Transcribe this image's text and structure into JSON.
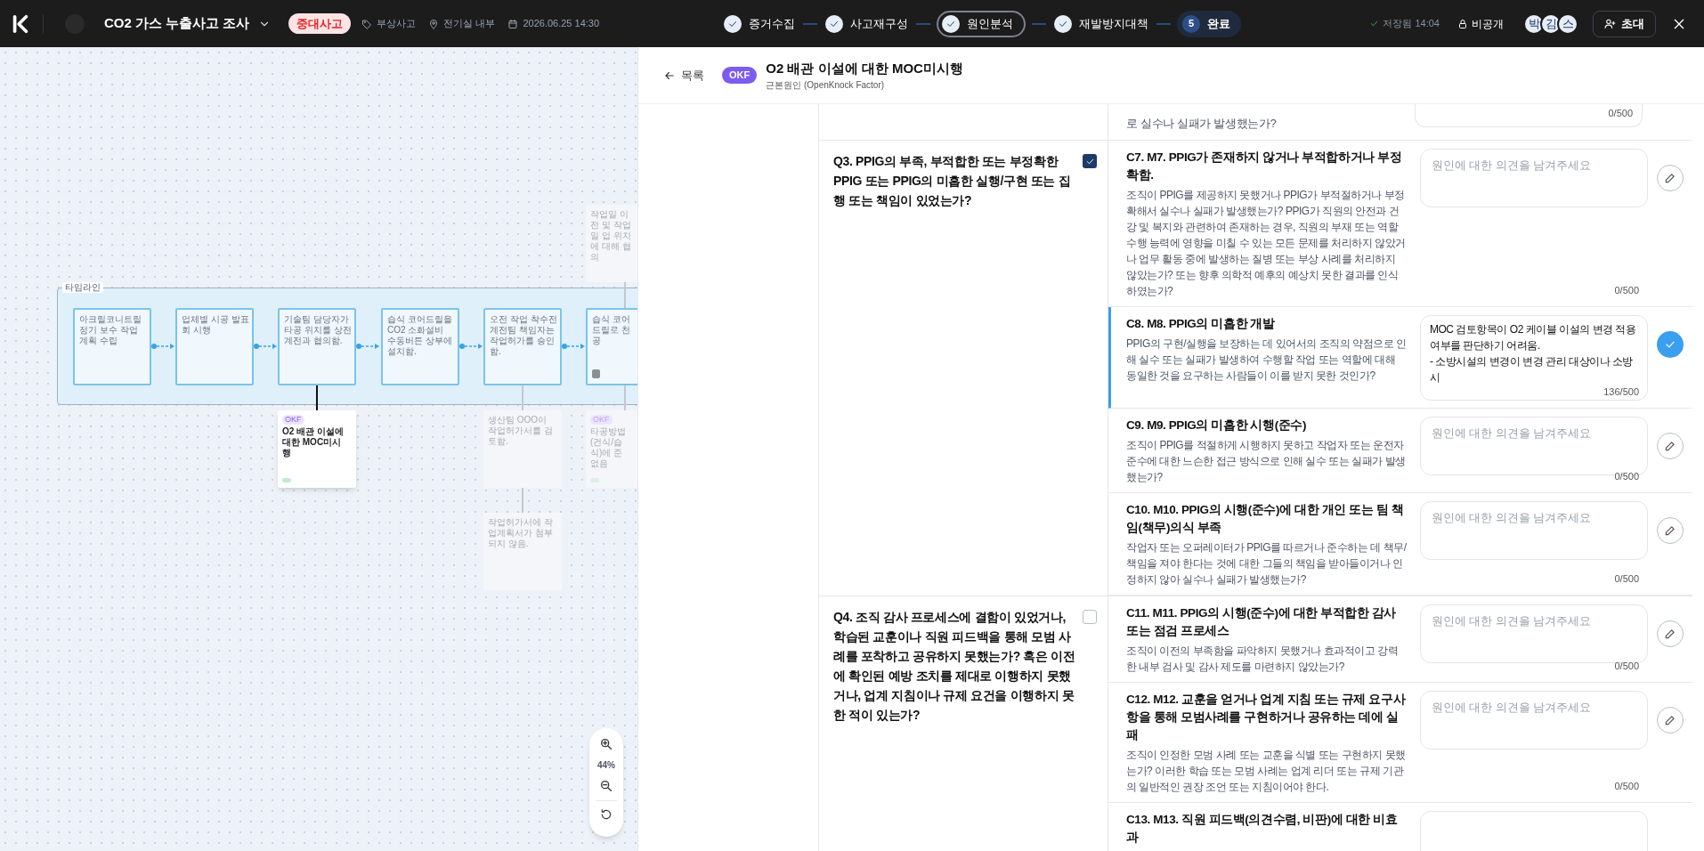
{
  "topbar": {
    "title": "CO2 가스 누출사고 조사",
    "severity": "중대사고",
    "meta": [
      {
        "kind": "tag",
        "text": "부상사고"
      },
      {
        "kind": "location",
        "text": "전기실 내부"
      },
      {
        "kind": "date",
        "text": "2026.06.25 14:30"
      }
    ],
    "steps": [
      {
        "label": "증거수집",
        "completed": true,
        "selected": false
      },
      {
        "label": "사고재구성",
        "completed": true,
        "selected": false
      },
      {
        "label": "원인분석",
        "completed": true,
        "selected": true
      },
      {
        "label": "재발방지대책",
        "completed": true,
        "selected": false
      },
      {
        "label": "완료",
        "completed": false,
        "selected": false,
        "number": "5"
      }
    ],
    "save_status": "저장됨 14:04",
    "visibility": "비공개",
    "avatars": [
      "박",
      "김",
      "스"
    ],
    "invite": "초대"
  },
  "canvas": {
    "group_label": "타임라인",
    "timeline_nodes": [
      {
        "text": "아크릴코니트릴 정기 보수 작업 계획 수립",
        "has_icon": false
      },
      {
        "text": "업체별 시공 발표회 시행",
        "has_icon": false
      },
      {
        "text": "기술팀 담당자가 타공 위치를 상전계전과 협의함.",
        "has_icon": false,
        "below": [
          {
            "kind": "okf",
            "badge": "OKF",
            "text": "O2 배관 이설에 대한 MOC미시행",
            "faded": false
          }
        ]
      },
      {
        "text": "습식 코어드릴을 CO2 소화설비 수동버튼 상부에 설치함.",
        "has_icon": false
      },
      {
        "text": "오전 작업 착수전 계전팀 책임자는 작업허가를 승인함.",
        "has_icon": false,
        "below": [
          {
            "kind": "note",
            "text": "생산팀 OOO이 작업허가서를 검토함.",
            "faded": true
          },
          {
            "kind": "note",
            "text": "작업허가서에 작업계획서가 첨부되지 않음.",
            "faded": true
          }
        ]
      },
      {
        "text": "습식 코어드릴로 천공",
        "has_icon": true,
        "above": [
          {
            "kind": "note",
            "text": "작업일 이전 및 작업일 업 위치에 대해 협의",
            "faded": true
          }
        ],
        "below": [
          {
            "kind": "okf",
            "badge": "OKF",
            "text": "타공방법(건식/습식)에 준 없음",
            "faded": true
          }
        ]
      }
    ],
    "zoom_level": "44%"
  },
  "panel": {
    "back": "목록",
    "badge": "OKF",
    "title": "O2 배관 이설에 대한 MOC미시행",
    "subtitle": "근본원인 (OpenKnock Factor)",
    "partial_row": {
      "text": "로 실수나 실패가 발생했는가?",
      "count": "0/500"
    },
    "questions": [
      {
        "text": "Q3. PPIG의 부족, 부적합한 또는 부정확한 PPIG 또는 PPIG의 미흡한 실행/구현 또는 집행 또는 책임이 있었는가?",
        "checked": true,
        "criteria": [
          {
            "title": "C7. M7. PPIG가 존재하지 않거나 부적합하거나 부정확함.",
            "description": "조직이 PPIG를 제공하지 못했거나 PPIG가 부적절하거나 부정확해서 실수나 실패가 발생했는가? PPIG가 직원의 안전과 건강 및 복지와 관련하여 존재하는 경우, 직원의 부재 또는 역할 수행 능력에 영향을 미칠 수 있는 모든 문제를 처리하지 않았거나 업무 활동 중에 발생하는 질병 또는 부상 사례를 처리하지 않았는가? 또는 향후 의학적 예후의 예상치 못한 결과를 인식하였는가?",
            "placeholder": "원인에 대한 의견을 남겨주세요",
            "count": "0/500",
            "selected": false,
            "saved": false
          },
          {
            "title": "C8. M8. PPIG의 미흡한 개발",
            "description": "PPIG의 구현/실행을 보장하는 데 있어서의 조직의 약점으로 인해 실수 또는 실패가 발생하여 수행할 작업 또는 역할에 대해 동일한 것을 요구하는 사람들이 이를 받지 못한 것인가?",
            "value": "MOC 검토항목이 O2 케이블 이설의 변경 적용여부를 판단하기 어려움.\n- 소방시설의 변경이 변경 관리 대상이나 소방 시",
            "count": "136/500",
            "selected": true,
            "saved": true
          },
          {
            "title": "C9. M9. PPIG의 미흡한 시행(준수)",
            "description": "조직이 PPIG를 적절하게 시행하지 못하고 작업자 또는 운전자 준수에 대한 느슨한 접근 방식으로 인해 실수 또는 실패가 발생했는가?",
            "placeholder": "원인에 대한 의견을 남겨주세요",
            "count": "0/500",
            "selected": false,
            "saved": false
          },
          {
            "title": "C10. M10. PPIG의 시행(준수)에 대한 개인 또는 팀 책임(책무)의식 부족",
            "description": "작업자 또는 오퍼레이터가 PPIG를 따르거나 준수하는 데 책무/책임을 져야 한다는 것에 대한 그들의 책임을 받아들이거나 인정하지 않아 실수나 실패가 발생했는가?",
            "placeholder": "원인에 대한 의견을 남겨주세요",
            "count": "0/500",
            "selected": false,
            "saved": false
          }
        ]
      },
      {
        "text": "Q4. 조직 감사 프로세스에 결함이 있었거나, 학습된 교훈이나 직원 피드백을 통해 모범 사례를 포착하고 공유하지 못했는가? 혹은 이전에 확인된 예방 조치를 제대로 이행하지 못했거나, 업계 지침이나 규제 요건을 이행하지 못한 적이 있는가?",
        "checked": false,
        "criteria": [
          {
            "title": "C11. M11. PPIG의 시행(준수)에 대한 부적합한 감사 또는 점검 프로세스",
            "description": "조직이 이전의 부족함을 파악하지 못했거나 효과적이고 강력한 내부 검사 및 감사 제도를 마련하지 않았는가?",
            "placeholder": "원인에 대한 의견을 남겨주세요",
            "count": "0/500",
            "selected": false,
            "saved": false
          },
          {
            "title": "C12. M12. 교훈을 얻거나 업계 지침 또는 규제 요구사항을 통해 모범사례를 구현하거나 공유하는 데에 실패",
            "description": "조직이 인정한 모범 사례 또는 교훈을 식별 또는 구현하지 못했는가? 이러한 학습 또는 모범 사례는 업계 리더 또는 규제 기관의 일반적인 권장 조언 또는 지침이어야 한다.",
            "placeholder": "원인에 대한 의견을 남겨주세요",
            "count": "0/500",
            "selected": false,
            "saved": false
          },
          {
            "title": "C13. M13. 직원 피드백(의견수렴, 비판)에 대한 비효과",
            "selected": false
          }
        ]
      }
    ]
  }
}
